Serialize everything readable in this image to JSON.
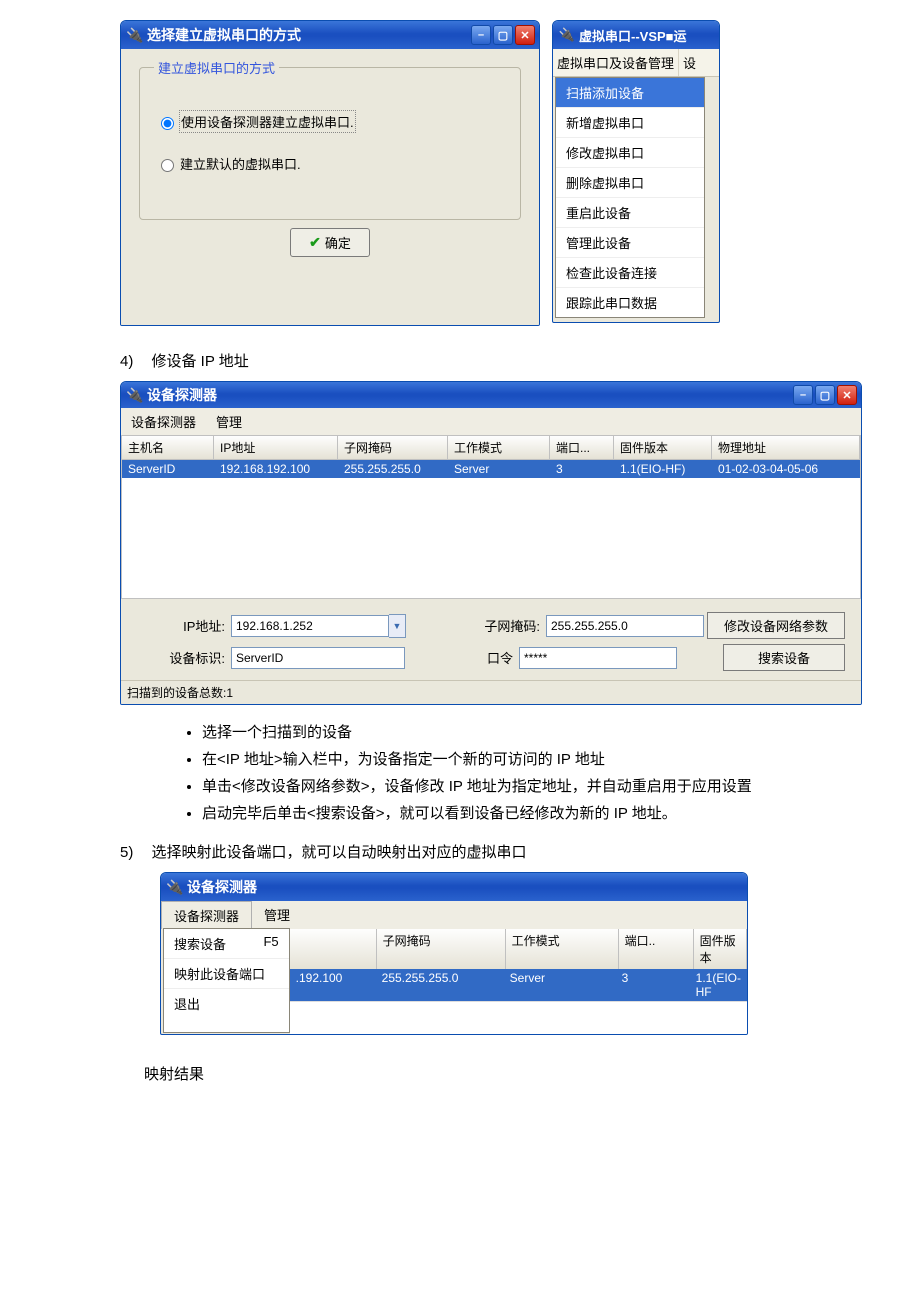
{
  "dlg1": {
    "title": "选择建立虚拟串口的方式",
    "group_label": "建立虚拟串口的方式",
    "radio1": "使用设备探测器建立虚拟串口.",
    "radio2": "建立默认的虚拟串口.",
    "ok": "确定"
  },
  "dlg2": {
    "title": "虚拟串口--VSP■运",
    "menu_main": "虚拟串口及设备管理",
    "menu_right": "设",
    "items": [
      "扫描添加设备",
      "新增虚拟串口",
      "修改虚拟串口",
      "删除虚拟串口",
      "重启此设备",
      "管理此设备",
      "检查此设备连接",
      "跟踪此串口数据"
    ]
  },
  "step4": {
    "idx": "4)",
    "text": "修设备 IP 地址"
  },
  "dlg3": {
    "title": "设备探测器",
    "menu": [
      "设备探测器",
      "管理"
    ],
    "cols": [
      "主机名",
      "IP地址",
      "子网掩码",
      "工作模式",
      "端口...",
      "固件版本",
      "物理地址"
    ],
    "row": {
      "host": "ServerID",
      "ip": "192.168.192.100",
      "mask": "255.255.255.0",
      "mode": "Server",
      "port": "3",
      "fw": "1.1(EIO-HF)",
      "mac": "01-02-03-04-05-06"
    },
    "lbl_ip": "IP地址:",
    "val_ip": "192.168.1.252",
    "lbl_mask": "子网掩码:",
    "val_mask": "255.255.255.0",
    "btn_modify": "修改设备网络参数",
    "lbl_id": "设备标识:",
    "val_id": "ServerID",
    "lbl_pwd": "口令",
    "val_pwd": "*****",
    "btn_search": "搜索设备",
    "status": "扫描到的设备总数:1"
  },
  "bullets": [
    "选择一个扫描到的设备",
    "在<IP 地址>输入栏中，为设备指定一个新的可访问的 IP 地址",
    "单击<修改设备网络参数>，设备修改 IP 地址为指定地址，并自动重启用于应用设置",
    "启动完毕后单击<搜索设备>，就可以看到设备已经修改为新的 IP 地址。"
  ],
  "step5": {
    "idx": "5)",
    "text": "选择映射此设备端口，就可以自动映射出对应的虚拟串口"
  },
  "dlg4": {
    "title": "设备探测器",
    "menu_open": "设备探测器",
    "menu_other": "管理",
    "dropdown": [
      {
        "label": "搜索设备",
        "accel": "F5"
      },
      {
        "label": "映射此设备端口",
        "accel": ""
      },
      {
        "label": "退出",
        "accel": ""
      }
    ],
    "cols": [
      "子网掩码",
      "工作模式",
      "端口..",
      "固件版本"
    ],
    "row": {
      "ip": ".192.100",
      "mask": "255.255.255.0",
      "mode": "Server",
      "port": "3",
      "fw": "1.1(EIO-HF"
    }
  },
  "map_result": "映射结果"
}
